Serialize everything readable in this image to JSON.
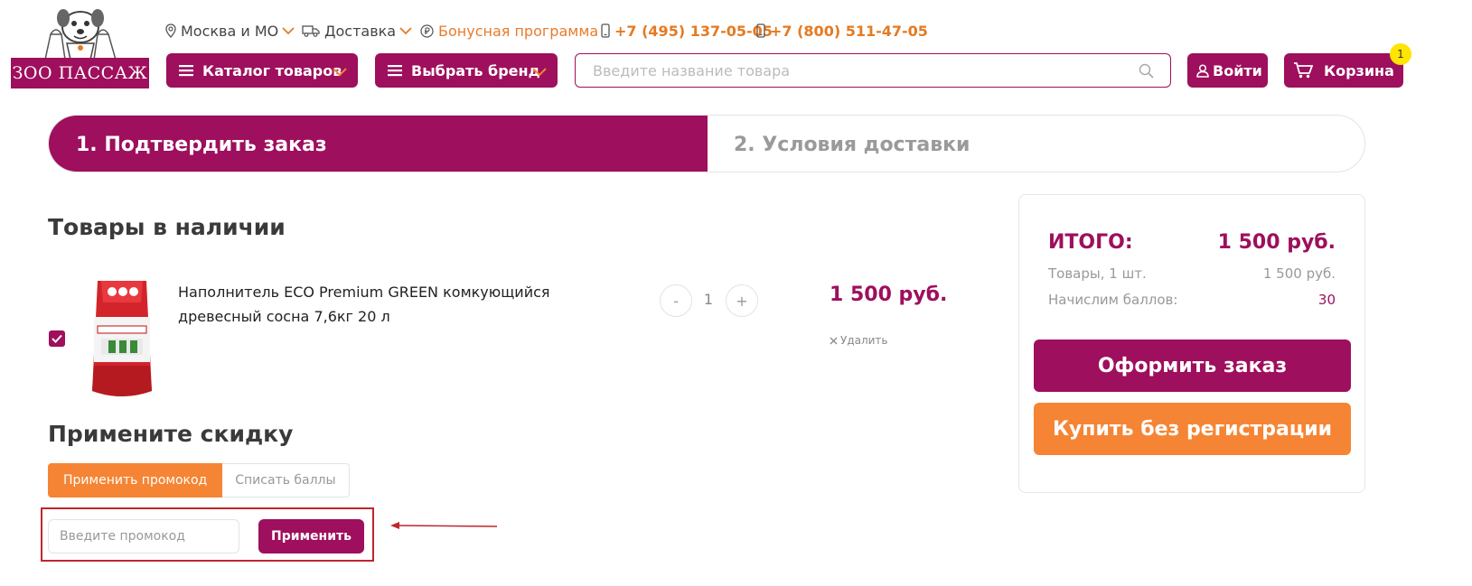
{
  "header": {
    "logo_text": "ЗОО ПАССАЖ",
    "region": "Москва и МО",
    "delivery": "Доставка",
    "bonus": "Бонусная программа",
    "phone1": "+7 (495) 137-05-05",
    "phone2": "+7 (800) 511-47-05",
    "catalog_btn": "Каталог товаров",
    "brand_btn": "Выбрать бренд",
    "search_placeholder": "Введите название товара",
    "login_btn": "Войти",
    "cart_btn": "Корзина",
    "cart_count": "1"
  },
  "steps": {
    "step1": "1. Подтвердить заказ",
    "step2": "2. Условия доставки"
  },
  "cart": {
    "section_title": "Товары в наличии",
    "item": {
      "name": "Наполнитель ECO Premium GREEN комкующийся древесный сосна 7,6кг 20 л",
      "qty": "1",
      "minus": "-",
      "plus": "+",
      "price": "1 500 руб.",
      "remove": "Удалить"
    }
  },
  "discount": {
    "title": "Примените скидку",
    "tab_promo": "Применить промокод",
    "tab_points": "Списать баллы",
    "promo_placeholder": "Введите промокод",
    "apply_btn": "Применить"
  },
  "summary": {
    "title": "ИТОГО:",
    "total": "1 500 руб.",
    "goods_label": "Товары, 1 шт.",
    "goods_value": "1 500 руб.",
    "points_label": "Начислим баллов:",
    "points_value": "30",
    "order_btn": "Оформить заказ",
    "guest_btn": "Купить без регистрации"
  },
  "colors": {
    "brand": "#9e0f5d",
    "accent": "#f58534",
    "highlight": "#c0262e"
  }
}
